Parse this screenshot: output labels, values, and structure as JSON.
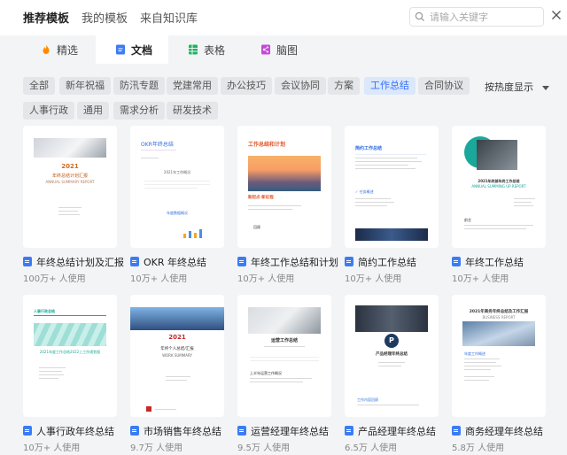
{
  "top_tabs": [
    {
      "label": "推荐模板",
      "active": true
    },
    {
      "label": "我的模板",
      "active": false
    },
    {
      "label": "来自知识库",
      "active": false
    }
  ],
  "search": {
    "placeholder": "请输入关键字"
  },
  "type_tabs": [
    {
      "label": "精选",
      "icon": "flame-icon",
      "active": false
    },
    {
      "label": "文档",
      "icon": "doc-icon",
      "active": true
    },
    {
      "label": "表格",
      "icon": "sheet-icon",
      "active": false
    },
    {
      "label": "脑图",
      "icon": "mindmap-icon",
      "active": false
    }
  ],
  "categories": [
    "全部",
    "新年祝福",
    "防汛专题",
    "党建常用",
    "办公技巧",
    "会议协同",
    "方案",
    "工作总结",
    "合同协议",
    "人事行政",
    "通用",
    "需求分析",
    "研发技术"
  ],
  "active_category": "工作总结",
  "sort_label": "按热度显示",
  "templates": [
    {
      "name": "年终总结计划及汇报",
      "usage": "100万+ 人使用",
      "thumb": {
        "t1": "2021",
        "t2": "年终总结计划汇报",
        "t3": "ANNUAL SUMMARY REPORT"
      }
    },
    {
      "name": "OKR 年终总结",
      "usage": "10万+ 人使用",
      "thumb": {
        "t1": "OKR年终总结",
        "t2": "2021年工作概况",
        "t3": "年度数据概况"
      }
    },
    {
      "name": "年终工作总结和计划",
      "usage": "10万+ 人使用",
      "thumb": {
        "t1": "工作总结和计划",
        "t2": "新起点·新征程",
        "t3": "回顾"
      }
    },
    {
      "name": "简约工作总结",
      "usage": "10万+ 人使用",
      "thumb": {
        "t1": "简约工作总结",
        "t2": "✓ 任务概述"
      }
    },
    {
      "name": "年终工作总结",
      "usage": "10万+ 人使用",
      "thumb": {
        "t1": "2021年终部年终工作总结",
        "t2": "ANNUAL SUMMING UP REPORT",
        "t3": "前言"
      }
    },
    {
      "name": "人事行政年终总结",
      "usage": "10万+ 人使用",
      "thumb": {
        "t1": "人事行政总结",
        "t2": "2021年度工作总结2022上工作规划报"
      }
    },
    {
      "name": "市场销售年终总结",
      "usage": "9.7万 人使用",
      "thumb": {
        "t1": "2021",
        "t2": "年终个人总结/汇报",
        "t3": "WORK SUMMARY"
      }
    },
    {
      "name": "运营经理年终总结",
      "usage": "9.5万 人使用",
      "thumb": {
        "t1": "运营工作总结",
        "t2": "上半年运营工作概况"
      }
    },
    {
      "name": "产品经理年终总结",
      "usage": "6.5万 人使用",
      "thumb": {
        "t1": "产品经理年终总结",
        "t2": "工作内容回顾"
      }
    },
    {
      "name": "商务经理年终总结",
      "usage": "5.8万 人使用",
      "thumb": {
        "t1": "2021年商务年终总结及工作汇报",
        "t2": "BUSINESS REPORT",
        "t3": "年度工作概述"
      }
    }
  ],
  "colors": {
    "accent": "#3370ff",
    "active_chip_bg": "#dbe8fb",
    "doc_icon": "#3b7cf4",
    "panel_bg": "#f3f4f6"
  }
}
